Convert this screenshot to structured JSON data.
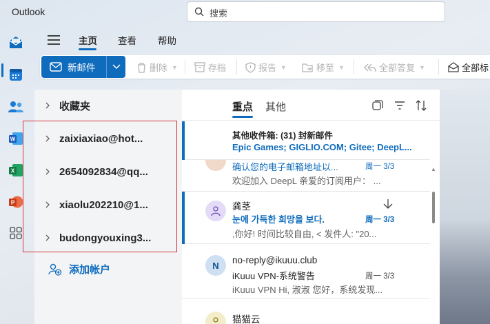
{
  "app": {
    "title": "Outlook"
  },
  "search": {
    "placeholder": "搜索"
  },
  "ribbon": {
    "tabs": [
      "主页",
      "查看",
      "帮助"
    ],
    "new_mail": "新邮件",
    "actions": [
      "删除",
      "存档",
      "报告",
      "移至",
      "全部答复",
      "全部标"
    ]
  },
  "folders": {
    "favorites": "收藏夹",
    "accounts": [
      "zaixiaxiao@hot...",
      "2654092834@qq...",
      "xiaolu202210@1...",
      "budongyouxing3..."
    ],
    "add_account": "添加帐户"
  },
  "list": {
    "tabs": [
      "重点",
      "其他"
    ],
    "other_banner": {
      "title": "其他收件箱: (31) 封新邮件",
      "senders": "Epic Games; GIGLIO.COM; Gitee; DeepL..."
    },
    "messages": [
      {
        "sender": "",
        "subject": "确认您的电子邮箱地址以...",
        "date": "周一 3/3",
        "preview": "欢迎加入 DeepL 亲爱的订阅用户：  ...",
        "avatar": "",
        "unread": false
      },
      {
        "sender": "龚茎",
        "subject": "눈에 가득한 희망을 보다.",
        "date": "周一 3/3",
        "preview": ",你好! 时间比较自由, < 发件人: \"20...",
        "avatar": "person",
        "unread": true
      },
      {
        "sender": "no-reply@ikuuu.club",
        "subject": "iKuuu VPN-系统警告",
        "date": "周一 3/3",
        "preview": "iKuuu VPN Hi, 淑淑 您好，系统发现...",
        "avatar": "N",
        "unread": false
      },
      {
        "sender": "猫猫云",
        "subject": "",
        "date": "",
        "preview": "",
        "avatar": "person",
        "unread": false
      }
    ]
  },
  "colors": {
    "accent": "#0f6cbd",
    "highlight_frame": "#d13438"
  }
}
